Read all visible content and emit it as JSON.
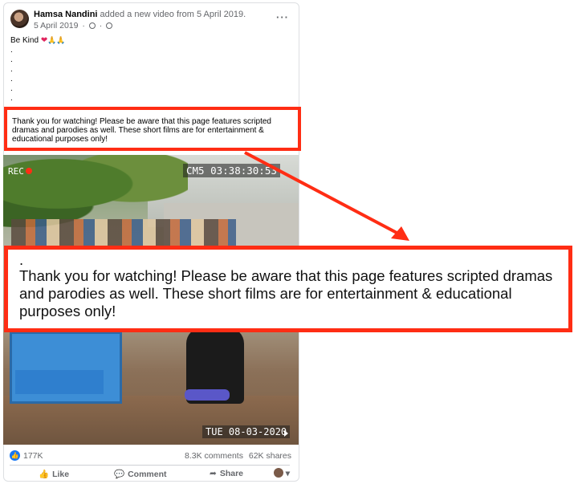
{
  "post": {
    "author": "Hamsa Nandini",
    "action": "added a new video from 5 April 2019.",
    "date": "5 April 2019",
    "meta_sep": "·",
    "more": "···",
    "caption": "Be Kind",
    "caption_dots": [
      ".",
      ".",
      ".",
      ".",
      ".",
      ".",
      "."
    ],
    "disclaimer": "Thank you for watching! Please be aware that this page features scripted dramas and parodies as well. These short films are for entertainment & educational purposes only!"
  },
  "video": {
    "rec_label": "REC",
    "cam_time": "CM5 03:38:30:53",
    "cam_date": "TUE 08-03-2020"
  },
  "zoom_callout": {
    "dot": ".",
    "text": "Thank you for watching! Please be aware that this page features scripted dramas and parodies as well. These short films are for entertainment & educational purposes only!"
  },
  "stats": {
    "likes": "177K",
    "comments": "8.3K comments",
    "shares": "62K shares"
  },
  "actions": {
    "like": "Like",
    "comment": "Comment",
    "share": "Share"
  },
  "colors": {
    "highlight": "#ff2d14",
    "facebook_blue": "#1877f2"
  },
  "icons": {
    "avatar": "profile-photo",
    "globe": "globe-icon",
    "heart": "heart-emoji",
    "hands": "praying-hands-emoji",
    "like": "thumbs-up-icon",
    "comment": "speech-bubble-icon",
    "share": "share-arrow-icon"
  }
}
